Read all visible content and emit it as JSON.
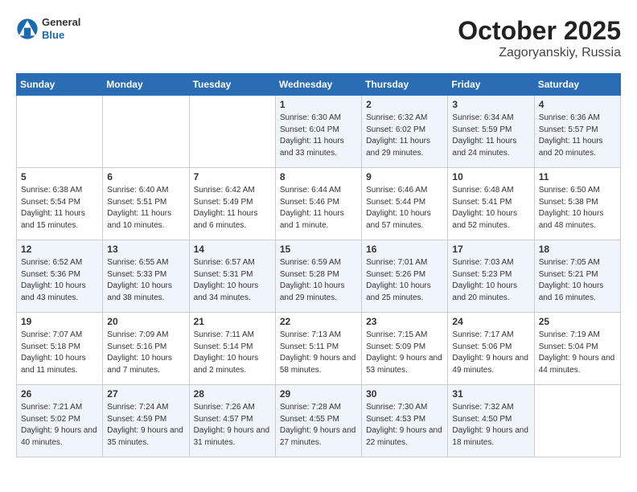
{
  "header": {
    "logo_general": "General",
    "logo_blue": "Blue",
    "title": "October 2025",
    "location": "Zagoryanskiy, Russia"
  },
  "days_of_week": [
    "Sunday",
    "Monday",
    "Tuesday",
    "Wednesday",
    "Thursday",
    "Friday",
    "Saturday"
  ],
  "weeks": [
    [
      {
        "day": "",
        "sunrise": "",
        "sunset": "",
        "daylight": ""
      },
      {
        "day": "",
        "sunrise": "",
        "sunset": "",
        "daylight": ""
      },
      {
        "day": "",
        "sunrise": "",
        "sunset": "",
        "daylight": ""
      },
      {
        "day": "1",
        "sunrise": "Sunrise: 6:30 AM",
        "sunset": "Sunset: 6:04 PM",
        "daylight": "Daylight: 11 hours and 33 minutes."
      },
      {
        "day": "2",
        "sunrise": "Sunrise: 6:32 AM",
        "sunset": "Sunset: 6:02 PM",
        "daylight": "Daylight: 11 hours and 29 minutes."
      },
      {
        "day": "3",
        "sunrise": "Sunrise: 6:34 AM",
        "sunset": "Sunset: 5:59 PM",
        "daylight": "Daylight: 11 hours and 24 minutes."
      },
      {
        "day": "4",
        "sunrise": "Sunrise: 6:36 AM",
        "sunset": "Sunset: 5:57 PM",
        "daylight": "Daylight: 11 hours and 20 minutes."
      }
    ],
    [
      {
        "day": "5",
        "sunrise": "Sunrise: 6:38 AM",
        "sunset": "Sunset: 5:54 PM",
        "daylight": "Daylight: 11 hours and 15 minutes."
      },
      {
        "day": "6",
        "sunrise": "Sunrise: 6:40 AM",
        "sunset": "Sunset: 5:51 PM",
        "daylight": "Daylight: 11 hours and 10 minutes."
      },
      {
        "day": "7",
        "sunrise": "Sunrise: 6:42 AM",
        "sunset": "Sunset: 5:49 PM",
        "daylight": "Daylight: 11 hours and 6 minutes."
      },
      {
        "day": "8",
        "sunrise": "Sunrise: 6:44 AM",
        "sunset": "Sunset: 5:46 PM",
        "daylight": "Daylight: 11 hours and 1 minute."
      },
      {
        "day": "9",
        "sunrise": "Sunrise: 6:46 AM",
        "sunset": "Sunset: 5:44 PM",
        "daylight": "Daylight: 10 hours and 57 minutes."
      },
      {
        "day": "10",
        "sunrise": "Sunrise: 6:48 AM",
        "sunset": "Sunset: 5:41 PM",
        "daylight": "Daylight: 10 hours and 52 minutes."
      },
      {
        "day": "11",
        "sunrise": "Sunrise: 6:50 AM",
        "sunset": "Sunset: 5:38 PM",
        "daylight": "Daylight: 10 hours and 48 minutes."
      }
    ],
    [
      {
        "day": "12",
        "sunrise": "Sunrise: 6:52 AM",
        "sunset": "Sunset: 5:36 PM",
        "daylight": "Daylight: 10 hours and 43 minutes."
      },
      {
        "day": "13",
        "sunrise": "Sunrise: 6:55 AM",
        "sunset": "Sunset: 5:33 PM",
        "daylight": "Daylight: 10 hours and 38 minutes."
      },
      {
        "day": "14",
        "sunrise": "Sunrise: 6:57 AM",
        "sunset": "Sunset: 5:31 PM",
        "daylight": "Daylight: 10 hours and 34 minutes."
      },
      {
        "day": "15",
        "sunrise": "Sunrise: 6:59 AM",
        "sunset": "Sunset: 5:28 PM",
        "daylight": "Daylight: 10 hours and 29 minutes."
      },
      {
        "day": "16",
        "sunrise": "Sunrise: 7:01 AM",
        "sunset": "Sunset: 5:26 PM",
        "daylight": "Daylight: 10 hours and 25 minutes."
      },
      {
        "day": "17",
        "sunrise": "Sunrise: 7:03 AM",
        "sunset": "Sunset: 5:23 PM",
        "daylight": "Daylight: 10 hours and 20 minutes."
      },
      {
        "day": "18",
        "sunrise": "Sunrise: 7:05 AM",
        "sunset": "Sunset: 5:21 PM",
        "daylight": "Daylight: 10 hours and 16 minutes."
      }
    ],
    [
      {
        "day": "19",
        "sunrise": "Sunrise: 7:07 AM",
        "sunset": "Sunset: 5:18 PM",
        "daylight": "Daylight: 10 hours and 11 minutes."
      },
      {
        "day": "20",
        "sunrise": "Sunrise: 7:09 AM",
        "sunset": "Sunset: 5:16 PM",
        "daylight": "Daylight: 10 hours and 7 minutes."
      },
      {
        "day": "21",
        "sunrise": "Sunrise: 7:11 AM",
        "sunset": "Sunset: 5:14 PM",
        "daylight": "Daylight: 10 hours and 2 minutes."
      },
      {
        "day": "22",
        "sunrise": "Sunrise: 7:13 AM",
        "sunset": "Sunset: 5:11 PM",
        "daylight": "Daylight: 9 hours and 58 minutes."
      },
      {
        "day": "23",
        "sunrise": "Sunrise: 7:15 AM",
        "sunset": "Sunset: 5:09 PM",
        "daylight": "Daylight: 9 hours and 53 minutes."
      },
      {
        "day": "24",
        "sunrise": "Sunrise: 7:17 AM",
        "sunset": "Sunset: 5:06 PM",
        "daylight": "Daylight: 9 hours and 49 minutes."
      },
      {
        "day": "25",
        "sunrise": "Sunrise: 7:19 AM",
        "sunset": "Sunset: 5:04 PM",
        "daylight": "Daylight: 9 hours and 44 minutes."
      }
    ],
    [
      {
        "day": "26",
        "sunrise": "Sunrise: 7:21 AM",
        "sunset": "Sunset: 5:02 PM",
        "daylight": "Daylight: 9 hours and 40 minutes."
      },
      {
        "day": "27",
        "sunrise": "Sunrise: 7:24 AM",
        "sunset": "Sunset: 4:59 PM",
        "daylight": "Daylight: 9 hours and 35 minutes."
      },
      {
        "day": "28",
        "sunrise": "Sunrise: 7:26 AM",
        "sunset": "Sunset: 4:57 PM",
        "daylight": "Daylight: 9 hours and 31 minutes."
      },
      {
        "day": "29",
        "sunrise": "Sunrise: 7:28 AM",
        "sunset": "Sunset: 4:55 PM",
        "daylight": "Daylight: 9 hours and 27 minutes."
      },
      {
        "day": "30",
        "sunrise": "Sunrise: 7:30 AM",
        "sunset": "Sunset: 4:53 PM",
        "daylight": "Daylight: 9 hours and 22 minutes."
      },
      {
        "day": "31",
        "sunrise": "Sunrise: 7:32 AM",
        "sunset": "Sunset: 4:50 PM",
        "daylight": "Daylight: 9 hours and 18 minutes."
      },
      {
        "day": "",
        "sunrise": "",
        "sunset": "",
        "daylight": ""
      }
    ]
  ]
}
